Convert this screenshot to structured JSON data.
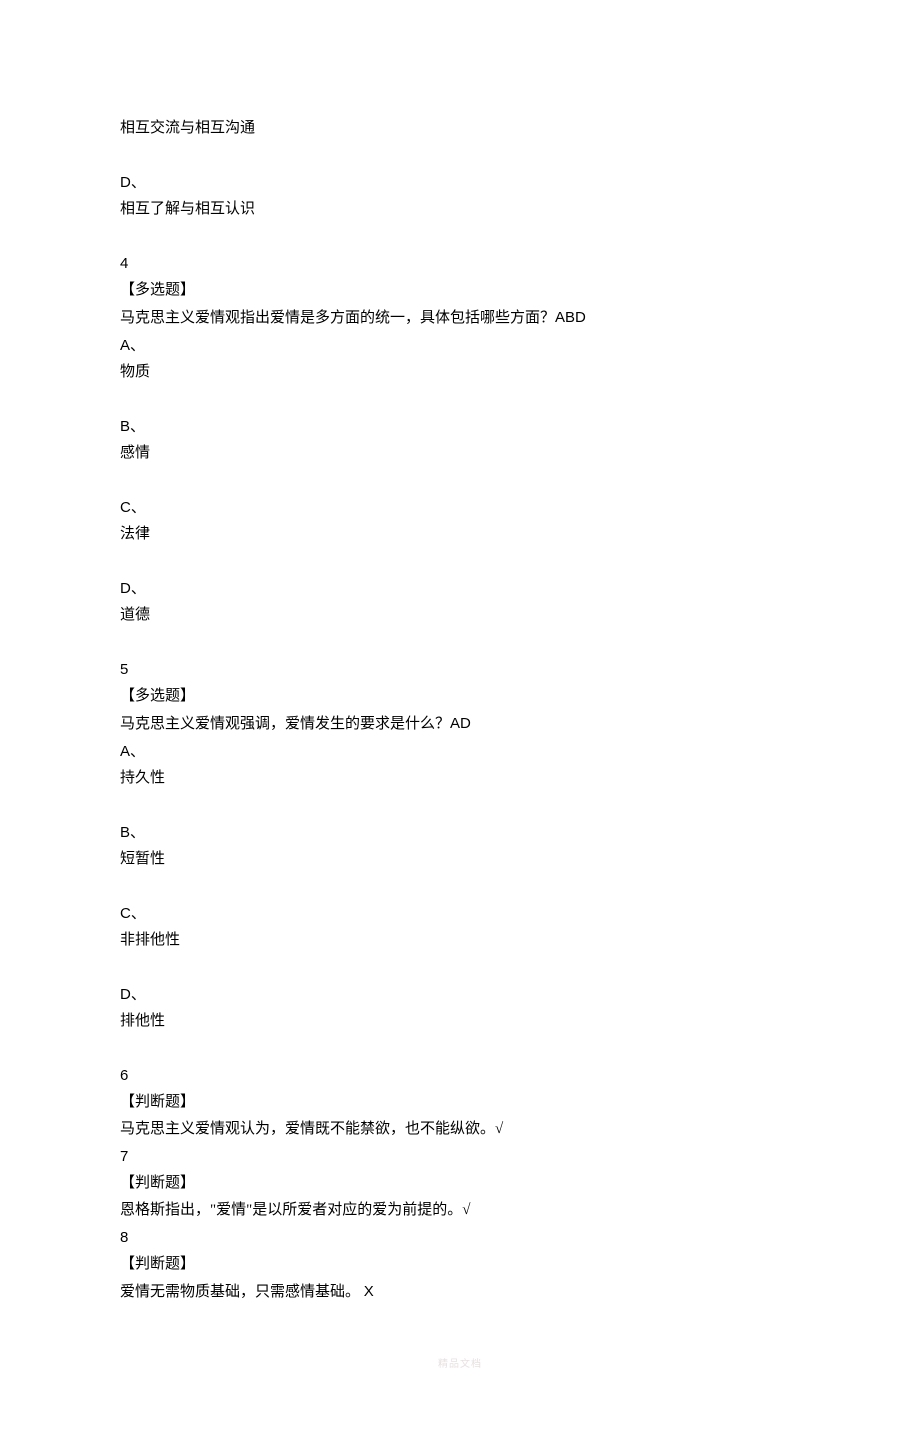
{
  "topBlock": {
    "lineC": "相互交流与相互沟通",
    "optionD": "D、",
    "lineD": "相互了解与相互认识"
  },
  "q4": {
    "num": "4",
    "type": "【多选题】",
    "question": "马克思主义爱情观指出爱情是多方面的统一，具体包括哪些方面？",
    "answerInline": "ABD",
    "options": [
      {
        "letter": "A、",
        "text": "物质"
      },
      {
        "letter": "B、",
        "text": "感情"
      },
      {
        "letter": "C、",
        "text": "法律"
      },
      {
        "letter": "D、",
        "text": "道德"
      }
    ]
  },
  "q5": {
    "num": "5",
    "type": "【多选题】",
    "question": "马克思主义爱情观强调，爱情发生的要求是什么？",
    "answerInline": "AD",
    "options": [
      {
        "letter": "A、",
        "text": "持久性"
      },
      {
        "letter": "B、",
        "text": "短暂性"
      },
      {
        "letter": "C、",
        "text": "非排他性"
      },
      {
        "letter": "D、",
        "text": "排他性"
      }
    ]
  },
  "q6": {
    "num": "6",
    "type": "【判断题】",
    "question": "马克思主义爱情观认为，爱情既不能禁欲，也不能纵欲。",
    "answerInline": "√"
  },
  "q7": {
    "num": "7",
    "type": "【判断题】",
    "question": "恩格斯指出，\"爱情\"是以所爱者对应的爱为前提的。",
    "answerInline": "√"
  },
  "q8": {
    "num": "8",
    "type": "【判断题】",
    "question": "爱情无需物质基础，只需感情基础。 ",
    "answerInline": "X"
  },
  "footer": "精品文档"
}
